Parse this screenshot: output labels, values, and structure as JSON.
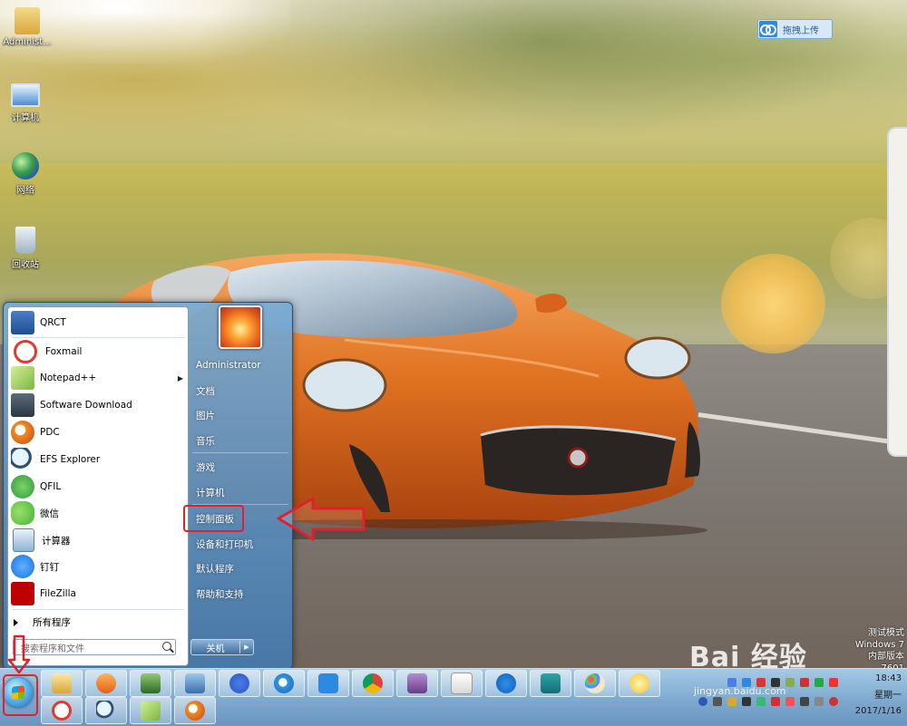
{
  "desktop": {
    "icons": [
      {
        "label": "Administ..."
      },
      {
        "label": "计算机"
      },
      {
        "label": "网络"
      },
      {
        "label": "回收站"
      }
    ],
    "upload_button": "拖拽上传",
    "os_watermark": [
      "测试模式",
      "Windows 7",
      "内部版本 7601"
    ]
  },
  "start_menu": {
    "programs": [
      {
        "label": "QRCT"
      },
      {
        "label": "Foxmail"
      },
      {
        "label": "Notepad++",
        "has_submenu": true
      },
      {
        "label": "Software Download"
      },
      {
        "label": "PDC"
      },
      {
        "label": "EFS Explorer"
      },
      {
        "label": "QFIL"
      },
      {
        "label": "微信"
      },
      {
        "label": "计算器"
      },
      {
        "label": "钉钉"
      },
      {
        "label": "FileZilla"
      }
    ],
    "all_programs": "所有程序",
    "search_placeholder": "搜索程序和文件",
    "right_items": [
      {
        "label": "Administrator"
      },
      {
        "label": "文档"
      },
      {
        "label": "图片"
      },
      {
        "label": "音乐"
      },
      {
        "label": "游戏"
      },
      {
        "label": "计算机"
      },
      {
        "label": "控制面板"
      },
      {
        "label": "设备和打印机"
      },
      {
        "label": "默认程序"
      },
      {
        "label": "帮助和支持"
      }
    ],
    "shutdown_label": "关机"
  },
  "taskbar": {
    "clock_time": "18:43",
    "clock_day": "星期一",
    "clock_date": "2017/1/16"
  },
  "watermark": {
    "brand": "Bai 经验",
    "url": "jingyan.baidu.com"
  },
  "colors": {
    "highlight_red": "#e0202a",
    "taskbar": "#8cb8de"
  }
}
